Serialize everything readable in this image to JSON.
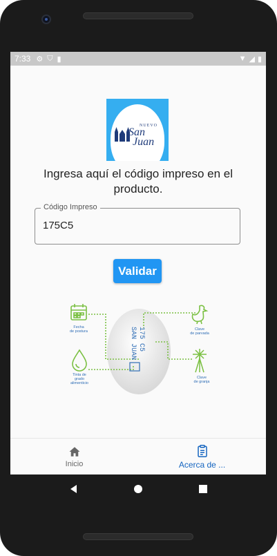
{
  "status_bar": {
    "time": "7:33",
    "left_icons": [
      "gear-icon",
      "shield-icon",
      "sd-card-icon"
    ],
    "right_icons": [
      "wifi-icon",
      "signal-icon",
      "battery-icon"
    ]
  },
  "logo": {
    "brand_small": "NUEVO",
    "brand_line1": "San",
    "brand_line2": "Juan"
  },
  "instruction": "Ingresa aquí el código impreso en el producto.",
  "code_field": {
    "label": "Código Impreso",
    "value": "175C5"
  },
  "validate_button": "Validar",
  "diagram": {
    "labels": {
      "fecha": "Fecha\nde postura",
      "tinta": "Tinta de\ngrado\nalimenticio",
      "parvada": "Clave\nde parvada",
      "granja": "Clave\nde granja"
    },
    "egg_print_line1": "SAN JUAN",
    "egg_print_line2": "175 C5",
    "accent_green": "#7bc043",
    "accent_blue": "#2f6db5"
  },
  "bottom_nav": {
    "items": [
      {
        "label": "Inicio",
        "icon": "home-icon",
        "active": false
      },
      {
        "label": "Acerca de ...",
        "icon": "clipboard-icon",
        "active": true
      }
    ]
  },
  "colors": {
    "primary": "#2196f3",
    "logo_bg": "#35aef0",
    "nav_active": "#1565c0"
  }
}
